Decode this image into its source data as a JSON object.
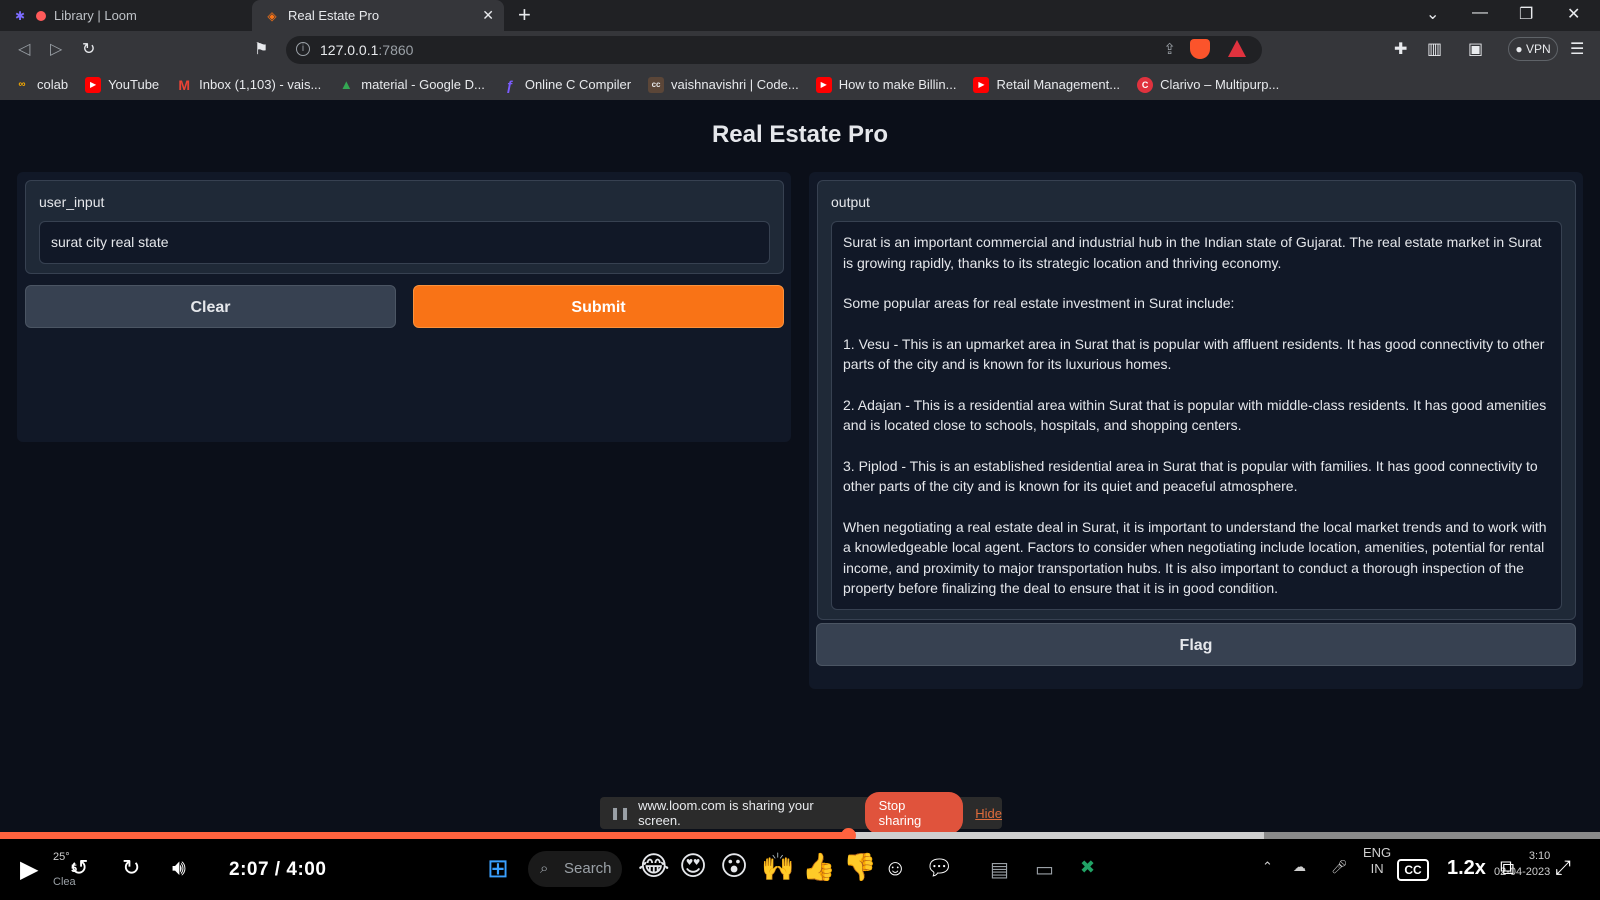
{
  "browser": {
    "tabs": [
      {
        "title": "Library | Loom",
        "active": false
      },
      {
        "title": "Real Estate Pro",
        "active": true
      }
    ],
    "url_host": "127.0.0.1",
    "url_port": ":7860",
    "vpn_label": "VPN",
    "bookmarks": [
      {
        "label": "colab",
        "icon": "colab-icon"
      },
      {
        "label": "YouTube",
        "icon": "youtube-icon"
      },
      {
        "label": "Inbox (1,103) - vais...",
        "icon": "gmail-icon"
      },
      {
        "label": "material - Google D...",
        "icon": "google-drive-icon"
      },
      {
        "label": "Online C Compiler",
        "icon": "compiler-icon"
      },
      {
        "label": "vaishnavishri | Code...",
        "icon": "codechef-icon"
      },
      {
        "label": "How to make Billin...",
        "icon": "youtube-icon"
      },
      {
        "label": "Retail Management...",
        "icon": "youtube-icon"
      },
      {
        "label": "Clarivo – Multipurp...",
        "icon": "clarivo-icon"
      }
    ]
  },
  "app": {
    "title": "Real Estate Pro",
    "input_label": "user_input",
    "input_value": "surat city real state",
    "clear_label": "Clear",
    "submit_label": "Submit",
    "output_label": "output",
    "output_paragraphs": [
      "Surat is an important commercial and industrial hub in the Indian state of Gujarat. The real estate market in Surat is growing rapidly, thanks to its strategic location and thriving economy.",
      "Some popular areas for real estate investment in Surat include:",
      "1. Vesu - This is an upmarket area in Surat that is popular with affluent residents. It has good connectivity to other parts of the city and is known for its luxurious homes.",
      "2. Adajan - This is a residential area within Surat that is popular with middle-class residents. It has good amenities and is located close to schools, hospitals, and shopping centers.",
      "3. Piplod - This is an established residential area in Surat that is popular with families. It has good connectivity to other parts of the city and is known for its quiet and peaceful atmosphere.",
      "When negotiating a real estate deal in Surat, it is important to understand the local market trends and to work with a knowledgeable local agent. Factors to consider when negotiating include location, amenities, potential for rental income, and proximity to major transportation hubs. It is also important to conduct a thorough inspection of the property before finalizing the deal to ensure that it is in good condition."
    ],
    "flag_label": "Flag",
    "colors": {
      "accent": "#f97316",
      "background": "#0b0f19",
      "panel": "#1f2937"
    }
  },
  "loom": {
    "sharing_text": "www.loom.com is sharing your screen.",
    "stop_label": "Stop sharing",
    "hide_label": "Hide",
    "current_time": "2:07",
    "total_time": "4:00",
    "played_fraction": 0.53,
    "buffered_fraction": 0.79,
    "speed_label": "1.2x",
    "cc_label": "CC",
    "skip_back_label": "5",
    "weather_temp": "25°",
    "weather_text": "Clea",
    "search_placeholder": "Search",
    "lang_top": "ENG",
    "lang_bottom": "IN",
    "clock_time": "3:10",
    "clock_date": "02-04-2023"
  }
}
